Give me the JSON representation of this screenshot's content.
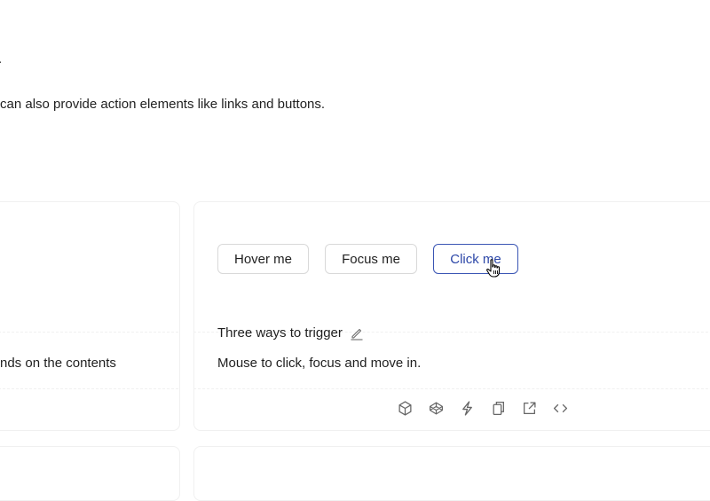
{
  "description": {
    "fragment": ".",
    "line": "can also provide action elements like links and buttons."
  },
  "left_card": {
    "text": "nds on the contents"
  },
  "demo": {
    "buttons": {
      "hover": "Hover me",
      "focus": "Focus me",
      "click": "Click me"
    },
    "title": "Three ways to trigger",
    "description": "Mouse to click, focus and move in."
  },
  "actions": [
    "codesandbox-icon",
    "codepen-icon",
    "stackblitz-icon",
    "copy-icon",
    "open-external-icon",
    "code-icon"
  ],
  "colors": {
    "primary_border": "#3a55b4",
    "primary_text": "#2c47a8",
    "default_border": "#d9d9d9",
    "card_border": "#f0f0f0"
  }
}
